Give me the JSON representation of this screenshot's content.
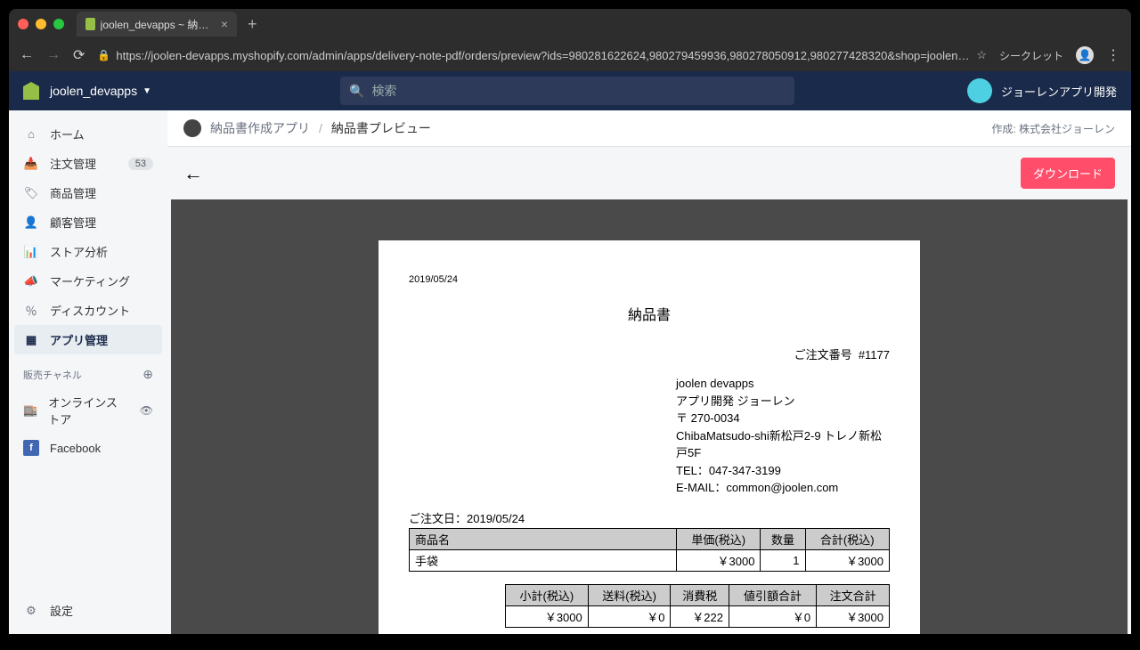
{
  "browser": {
    "tab_title": "joolen_devapps ~ 納品書作成ア",
    "url": "https://joolen-devapps.myshopify.com/admin/apps/delivery-note-pdf/orders/preview?ids=980281622624,980279459936,980278050912,980277428320&shop=joolen-devapps.mysho...",
    "incognito_label": "シークレット"
  },
  "header": {
    "shop_name": "joolen_devapps",
    "search_placeholder": "検索",
    "user_name": "ジョーレンアプリ開発"
  },
  "sidebar": {
    "items": [
      {
        "label": "ホーム"
      },
      {
        "label": "注文管理",
        "badge": "53"
      },
      {
        "label": "商品管理"
      },
      {
        "label": "顧客管理"
      },
      {
        "label": "ストア分析"
      },
      {
        "label": "マーケティング"
      },
      {
        "label": "ディスカウント"
      },
      {
        "label": "アプリ管理"
      }
    ],
    "channels_label": "販売チャネル",
    "channels": [
      {
        "label": "オンラインストア"
      },
      {
        "label": "Facebook"
      }
    ],
    "settings": "設定"
  },
  "breadcrumb": {
    "app_name": "納品書作成アプリ",
    "current": "納品書プレビュー",
    "created_by": "作成: 株式会社ジョーレン"
  },
  "toolbar": {
    "download_label": "ダウンロード"
  },
  "document": {
    "print_date": "2019/05/24",
    "title": "納品書",
    "order_number_label": "ご注文番号",
    "order_number": "#1177",
    "company": {
      "name": "joolen devapps",
      "dept": "アプリ開発 ジョーレン",
      "postal": "〒 270-0034",
      "address": "ChibaMatsudo-shi新松戸2-9 トレノ新松戸5F",
      "tel": "TEL：047-347-3199",
      "email": "E-MAIL：common@joolen.com"
    },
    "order_date_label": "ご注文日：",
    "order_date": "2019/05/24",
    "items_headers": {
      "name": "商品名",
      "unit_price": "単価(税込)",
      "qty": "数量",
      "total": "合計(税込)"
    },
    "items": [
      {
        "name": "手袋",
        "unit_price": "￥3000",
        "qty": "1",
        "total": "￥3000"
      }
    ],
    "totals_headers": {
      "subtotal": "小計(税込)",
      "shipping": "送料(税込)",
      "tax": "消費税",
      "discount": "値引額合計",
      "grand_total": "注文合計"
    },
    "totals": {
      "subtotal": "￥3000",
      "shipping": "￥0",
      "tax": "￥222",
      "discount": "￥0",
      "grand_total": "￥3000"
    }
  }
}
